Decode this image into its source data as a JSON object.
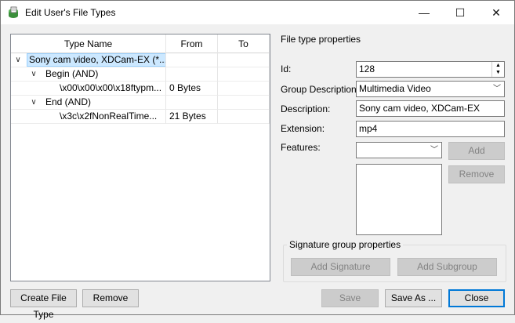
{
  "window": {
    "title": "Edit User's File Types",
    "min_glyph": "—",
    "max_glyph": "☐",
    "close_glyph": "✕"
  },
  "tree": {
    "columns": [
      "Type Name",
      "From",
      "To"
    ],
    "rows": [
      {
        "expander": "∨",
        "name": "Sony cam video, XDCam-EX (*...",
        "from": "",
        "to": "",
        "selected": true
      },
      {
        "expander": "∨",
        "name": "Begin (AND)",
        "from": "",
        "to": ""
      },
      {
        "expander": "",
        "name": "\\x00\\x00\\x00\\x18ftypm...",
        "from": "0 Bytes",
        "to": ""
      },
      {
        "expander": "∨",
        "name": "End (AND)",
        "from": "",
        "to": ""
      },
      {
        "expander": "",
        "name": "\\x3c\\x2fNonRealTime...",
        "from": "21 Bytes",
        "to": ""
      }
    ]
  },
  "buttons": {
    "create_file_type": "Create File Type",
    "remove": "Remove",
    "save": "Save",
    "save_as": "Save As ...",
    "close": "Close"
  },
  "properties": {
    "section_title": "File type properties",
    "id_label": "Id:",
    "id_value": "128",
    "group_label": "Group Description:",
    "group_value": "Multimedia Video",
    "description_label": "Description:",
    "description_value": "Sony cam video, XDCam-EX",
    "extension_label": "Extension:",
    "extension_value": "mp4",
    "features_label": "Features:",
    "features_value": "",
    "add_label": "Add",
    "remove_label": "Remove"
  },
  "signature_group": {
    "title": "Signature group properties",
    "add_signature": "Add Signature",
    "add_subgroup": "Add Subgroup"
  },
  "icons": {
    "app": "file-types-app-icon",
    "spin": "spin-up-down-icon",
    "dropdown": "chevron-down-icon",
    "expand": "tree-expander-icon"
  },
  "colors": {
    "selection_bg": "#cce8ff",
    "selection_border": "#99d1ff",
    "default_button_border": "#0078d7"
  }
}
